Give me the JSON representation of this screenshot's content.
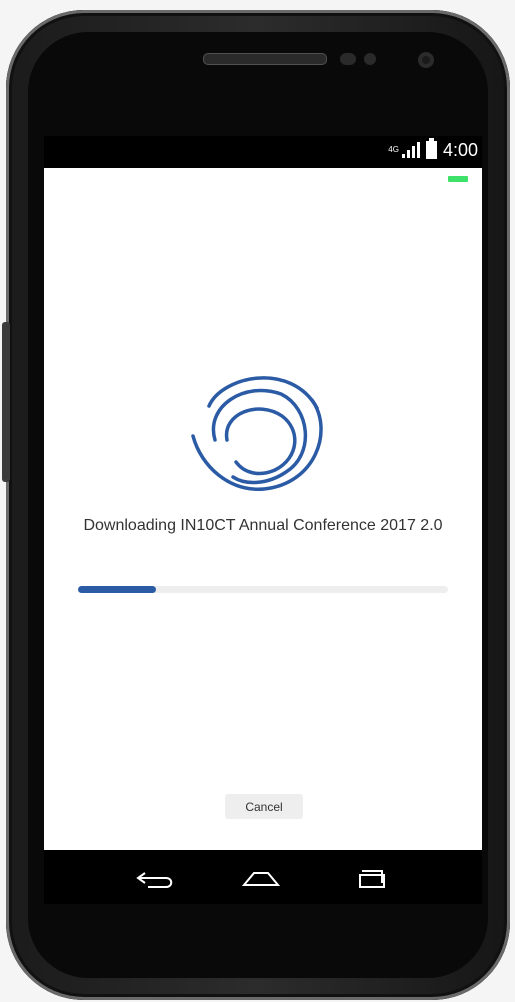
{
  "status_bar": {
    "network_label": "4G",
    "time": "4:00"
  },
  "download": {
    "message": "Downloading IN10CT Annual Conference 2017 2.0",
    "progress": 0.21,
    "progress_color": "#2b5ba5"
  },
  "actions": {
    "cancel_label": "Cancel"
  },
  "navigation": {
    "back_icon": "back-icon",
    "home_icon": "home-icon",
    "recent_icon": "recent-apps-icon"
  }
}
